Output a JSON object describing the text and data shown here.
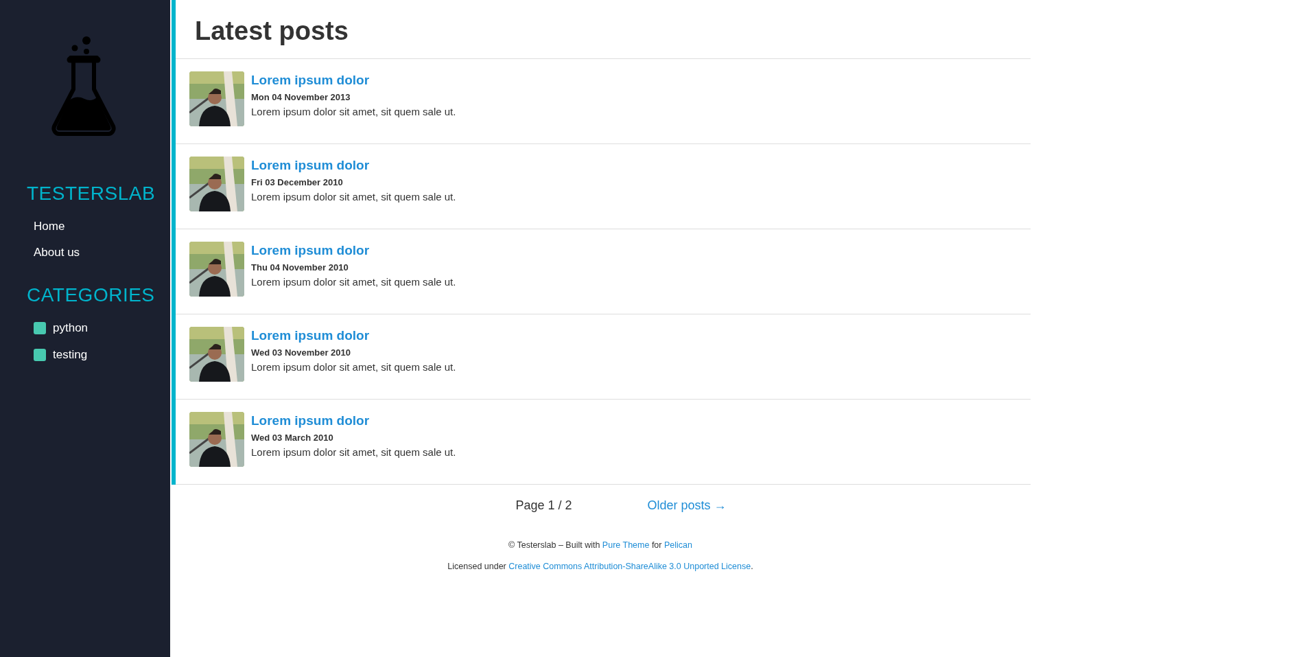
{
  "sidebar": {
    "brand": "TESTERSLAB",
    "nav": [
      {
        "label": "Home"
      },
      {
        "label": "About us"
      }
    ],
    "categories_title": "CATEGORIES",
    "categories": [
      {
        "label": "python",
        "color": "#48c9b0"
      },
      {
        "label": "testing",
        "color": "#48c9b0"
      }
    ]
  },
  "page_title": "Latest posts",
  "posts": [
    {
      "title": "Lorem ipsum dolor",
      "date": "Mon 04 November 2013",
      "summary": "Lorem ipsum dolor sit amet, sit quem sale ut."
    },
    {
      "title": "Lorem ipsum dolor",
      "date": "Fri 03 December 2010",
      "summary": "Lorem ipsum dolor sit amet, sit quem sale ut."
    },
    {
      "title": "Lorem ipsum dolor",
      "date": "Thu 04 November 2010",
      "summary": "Lorem ipsum dolor sit amet, sit quem sale ut."
    },
    {
      "title": "Lorem ipsum dolor",
      "date": "Wed 03 November 2010",
      "summary": "Lorem ipsum dolor sit amet, sit quem sale ut."
    },
    {
      "title": "Lorem ipsum dolor",
      "date": "Wed 03 March 2010",
      "summary": "Lorem ipsum dolor sit amet, sit quem sale ut."
    }
  ],
  "pagination": {
    "page": "Page 1 / 2",
    "older": "Older posts →"
  },
  "footer": [
    [
      {
        "kind": "text",
        "text": "© Testerslab – Built with "
      },
      {
        "kind": "link",
        "text": "Pure Theme"
      },
      {
        "kind": "text",
        "text": " for "
      },
      {
        "kind": "link",
        "text": "Pelican"
      }
    ],
    [
      {
        "kind": "text",
        "text": "Licensed under "
      },
      {
        "kind": "link",
        "text": "Creative Commons Attribution-ShareAlike 3.0 Unported License"
      },
      {
        "kind": "text",
        "text": "."
      }
    ]
  ]
}
